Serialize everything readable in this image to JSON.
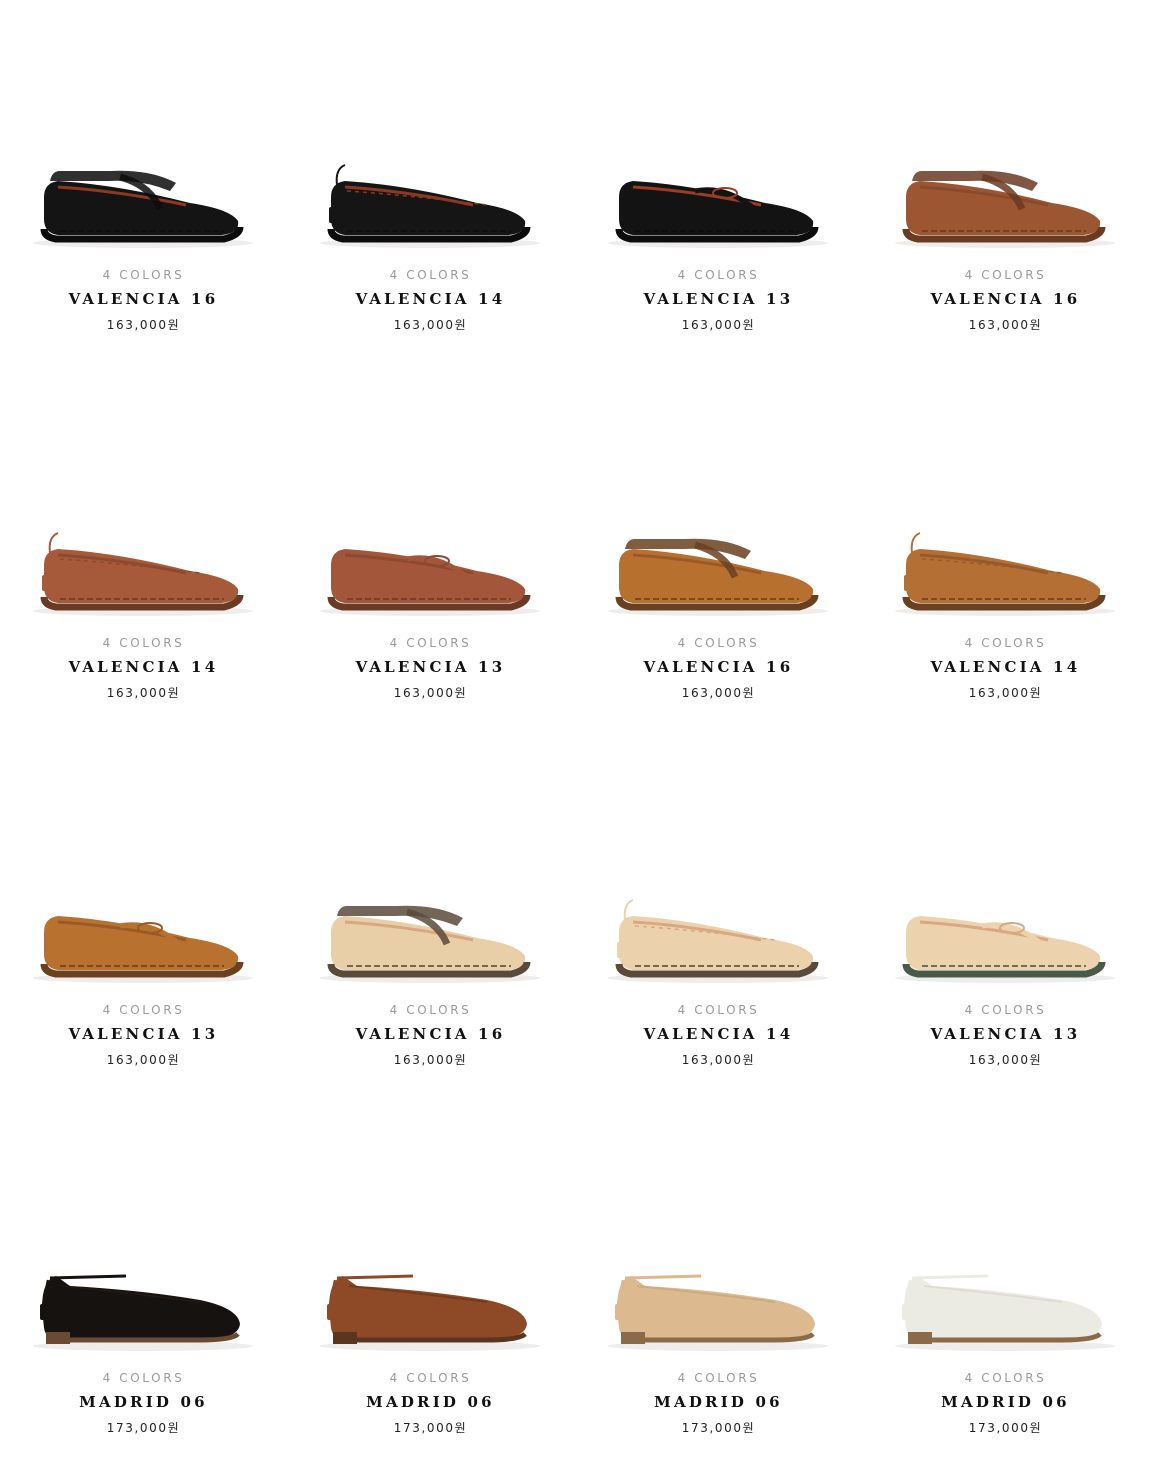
{
  "products": [
    {
      "colors": "4 COLORS",
      "name": "VALENCIA 16",
      "price": "163,000원",
      "style": "strap",
      "color": "#141414",
      "sole": "#0c0c0c",
      "lining": "#8a3a22"
    },
    {
      "colors": "4 COLORS",
      "name": "VALENCIA 14",
      "price": "163,000원",
      "style": "lace",
      "color": "#151515",
      "sole": "#0c0c0c",
      "lining": "#8a3a22"
    },
    {
      "colors": "4 COLORS",
      "name": "VALENCIA 13",
      "price": "163,000원",
      "style": "twist",
      "color": "#131313",
      "sole": "#0c0c0c",
      "lining": "#9a3d24"
    },
    {
      "colors": "4 COLORS",
      "name": "VALENCIA 16",
      "price": "163,000원",
      "style": "strap",
      "color": "#9c5632",
      "sole": "#6a3a22",
      "lining": "#8a4a2c"
    },
    {
      "colors": "4 COLORS",
      "name": "VALENCIA 14",
      "price": "163,000원",
      "style": "lace",
      "color": "#a65a3a",
      "sole": "#6b3a24",
      "lining": "#8c4a30"
    },
    {
      "colors": "4 COLORS",
      "name": "VALENCIA 13",
      "price": "163,000원",
      "style": "twist",
      "color": "#a4563a",
      "sole": "#6b3a24",
      "lining": "#8c4a30"
    },
    {
      "colors": "4 COLORS",
      "name": "VALENCIA 16",
      "price": "163,000원",
      "style": "strap",
      "color": "#b8702f",
      "sole": "#6a4020",
      "lining": "#9a5a28"
    },
    {
      "colors": "4 COLORS",
      "name": "VALENCIA 14",
      "price": "163,000원",
      "style": "lace",
      "color": "#b46f35",
      "sole": "#6a4020",
      "lining": "#9a5a28"
    },
    {
      "colors": "4 COLORS",
      "name": "VALENCIA 13",
      "price": "163,000원",
      "style": "twist",
      "color": "#b9712f",
      "sole": "#6a4020",
      "lining": "#9a5a28"
    },
    {
      "colors": "4 COLORS",
      "name": "VALENCIA 16",
      "price": "163,000원",
      "style": "strap",
      "color": "#e8cfa8",
      "sole": "#5a4a3a",
      "lining": "#d9a882"
    },
    {
      "colors": "4 COLORS",
      "name": "VALENCIA 14",
      "price": "163,000원",
      "style": "lace",
      "color": "#ebd2ad",
      "sole": "#5a4a3a",
      "lining": "#d9a882"
    },
    {
      "colors": "4 COLORS",
      "name": "VALENCIA 13",
      "price": "163,000원",
      "style": "twist",
      "color": "#ecd3ad",
      "sole": "#4a5a48",
      "lining": "#d9a882"
    },
    {
      "colors": "4 COLORS",
      "name": "MADRID 06",
      "price": "173,000원",
      "style": "madrid",
      "color": "#161210",
      "sole": "#6b4a34",
      "lining": "#2a1a12"
    },
    {
      "colors": "4 COLORS",
      "name": "MADRID 06",
      "price": "173,000원",
      "style": "madrid",
      "color": "#8e4a26",
      "sole": "#5a3620",
      "lining": "#6a341a"
    },
    {
      "colors": "4 COLORS",
      "name": "MADRID 06",
      "price": "173,000원",
      "style": "madrid",
      "color": "#dcb98e",
      "sole": "#8a6a48",
      "lining": "#c9a47a"
    },
    {
      "colors": "4 COLORS",
      "name": "MADRID 06",
      "price": "173,000원",
      "style": "madrid",
      "color": "#ecebe3",
      "sole": "#8a6a48",
      "lining": "#d8d6cc"
    }
  ]
}
